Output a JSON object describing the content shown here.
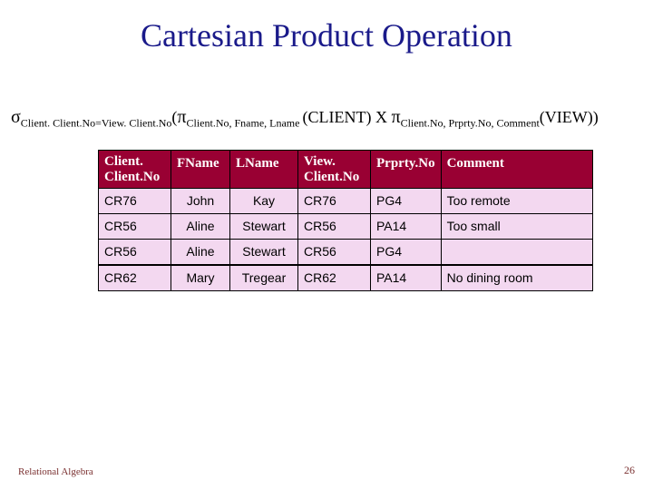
{
  "title": "Cartesian Product Operation",
  "formula": {
    "sigma": "σ",
    "sigma_sub": "Client. Client.No=View. Client.No",
    "open": "(",
    "pi1": "π",
    "pi1_sub": "Client.No, Fname, Lname ",
    "rel1": "(CLIENT) X ",
    "pi2": "π",
    "pi2_sub": "Client.No, Prprty.No, Comment",
    "rel2": "(VIEW))"
  },
  "headers": {
    "client_no_a": "Client.",
    "client_no_b": "Client.No",
    "fname": "FName",
    "lname": "LName",
    "view_no_a": "View.",
    "view_no_b": "Client.No",
    "prprty": "Prprty.No",
    "comment": "Comment"
  },
  "rows_block1": [
    {
      "client": "CR76",
      "fname": "John",
      "lname": "Kay",
      "view": "CR76",
      "prprty": "PG4",
      "comment": "Too remote"
    },
    {
      "client": "CR56",
      "fname": "Aline",
      "lname": "Stewart",
      "view": "CR56",
      "prprty": "PA14",
      "comment": "Too small"
    },
    {
      "client": "CR56",
      "fname": "Aline",
      "lname": "Stewart",
      "view": "CR56",
      "prprty": "PG4",
      "comment": ""
    }
  ],
  "rows_block2": [
    {
      "client": "CR62",
      "fname": "Mary",
      "lname": "Tregear",
      "view": "CR62",
      "prprty": "PA14",
      "comment": "No dining room"
    }
  ],
  "footer": {
    "left": "Relational Algebra",
    "right": "26"
  },
  "chart_data": {
    "type": "table",
    "title": "Cartesian Product Operation",
    "columns": [
      "Client.Client.No",
      "FName",
      "LName",
      "View.Client.No",
      "Prprty.No",
      "Comment"
    ],
    "rows": [
      [
        "CR76",
        "John",
        "Kay",
        "CR76",
        "PG4",
        "Too remote"
      ],
      [
        "CR56",
        "Aline",
        "Stewart",
        "CR56",
        "PA14",
        "Too small"
      ],
      [
        "CR56",
        "Aline",
        "Stewart",
        "CR56",
        "PG4",
        ""
      ],
      [
        "CR62",
        "Mary",
        "Tregear",
        "CR62",
        "PA14",
        "No dining room"
      ]
    ]
  }
}
